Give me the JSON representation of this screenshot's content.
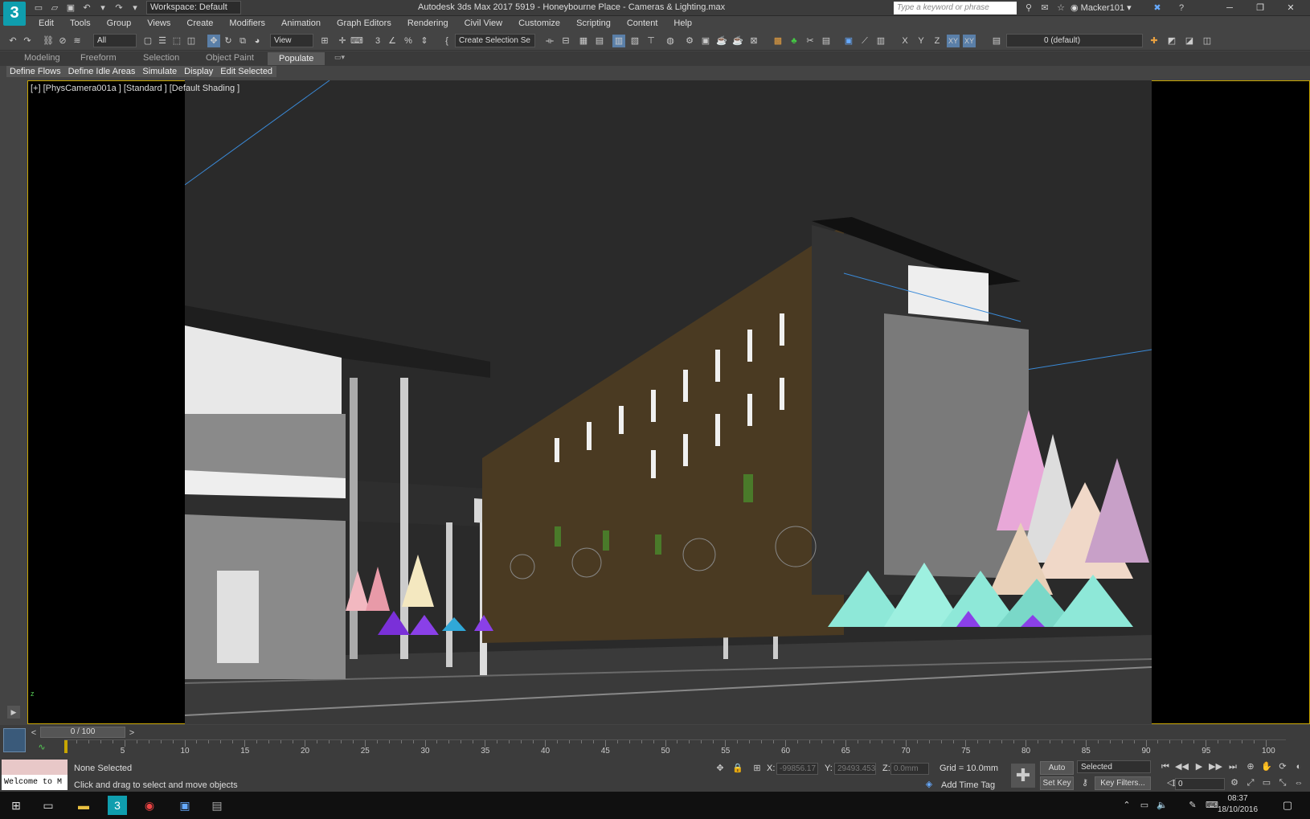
{
  "titlebar": {
    "app_icon": "3",
    "workspace": "Workspace: Default",
    "window_title": "Autodesk 3ds Max 2017      5919 - Honeybourne Place - Cameras & Lighting.max",
    "search_placeholder": "Type a keyword or phrase",
    "user": "Macker101",
    "user_chevron": "▾",
    "window_buttons": [
      "─",
      "❐",
      "✕"
    ]
  },
  "menu": [
    "Edit",
    "Tools",
    "Group",
    "Views",
    "Create",
    "Modifiers",
    "Animation",
    "Graph Editors",
    "Rendering",
    "Civil View",
    "Customize",
    "Scripting",
    "Content",
    "Help"
  ],
  "toolbar": {
    "filter": "All",
    "ref_coord": "View",
    "selection_set": "Create Selection Se",
    "axis_x": "X",
    "axis_y": "Y",
    "axis_z": "Z",
    "axis_xy": "XY",
    "axis_xy2": "XY",
    "layer": "0 (default)"
  },
  "ribbon": {
    "tabs": [
      "Modeling",
      "Freeform",
      "Selection",
      "Object Paint",
      "Populate"
    ],
    "active_tab": "Populate",
    "subtabs": [
      "Define Flows",
      "Define Idle Areas",
      "Simulate",
      "Display",
      "Edit Selected"
    ]
  },
  "viewport": {
    "label": "[+] [PhysCamera001a ] [Standard ] [Default Shading ]",
    "axis_label": "z"
  },
  "timeline": {
    "slider_text": "0 / 100",
    "frame_labels": [
      "5",
      "10",
      "15",
      "20",
      "25",
      "30",
      "35",
      "40",
      "45",
      "50",
      "55",
      "60",
      "65",
      "70",
      "75",
      "80",
      "85",
      "90",
      "95",
      "100"
    ]
  },
  "status": {
    "listener": "Welcome to M",
    "selection": "None Selected",
    "prompt": "Click and drag to select and move objects",
    "x_label": "X:",
    "x_value": "-99856.17",
    "y_label": "Y:",
    "y_value": "29493.453",
    "z_label": "Z:",
    "z_value": "0.0mm",
    "grid": "Grid = 10.0mm",
    "add_time_tag": "Add Time Tag",
    "auto_key": "Auto Key",
    "set_key": "Set Key",
    "selected_dropdown": "Selected",
    "key_filters": "Key Filters...",
    "frame_field": "0"
  },
  "taskbar": {
    "time": "08:37",
    "date": "18/10/2016"
  },
  "colors": {
    "viewport_border": "#c8a600",
    "accent_teal": "#0f9eae"
  }
}
